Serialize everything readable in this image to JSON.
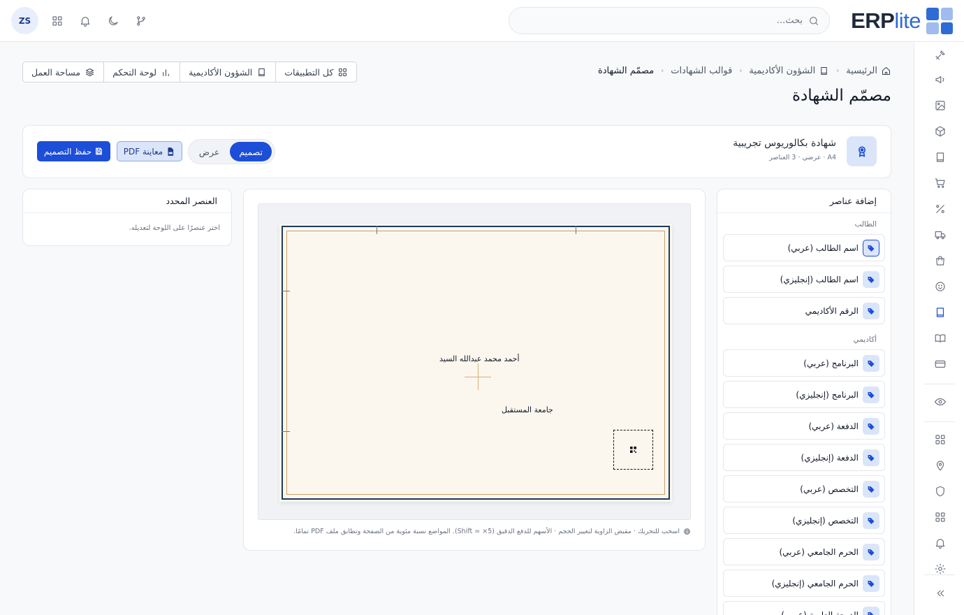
{
  "brand": {
    "name_main": "ERP",
    "name_suffix": "lite",
    "color": "#2f6bd7"
  },
  "header": {
    "search_placeholder": "بحث...",
    "user_initials": "ZS",
    "icons": [
      "git-branch-icon",
      "moon-icon",
      "bell-icon",
      "apps-grid-icon"
    ]
  },
  "sidebar": {
    "icons": [
      "tools-icon",
      "megaphone-icon",
      "image-icon",
      "box-icon",
      "book-icon",
      "cart-icon",
      "percent-icon",
      "truck-icon",
      "shopping-bag-icon",
      "smile-icon",
      "book-active-icon",
      "open-book-icon",
      "credit-card-icon",
      "eye-icon",
      "grid-icon",
      "map-pin-icon",
      "shield-icon",
      "grid-2-icon",
      "bell-icon",
      "settings-icon",
      "collapse-icon"
    ]
  },
  "breadcrumb": {
    "items": [
      "الرئيسية",
      "الشؤون الأكاديمية",
      "قوالب الشهادات",
      "مصمّم الشهادة"
    ]
  },
  "page_title": "مصمّم الشهادة",
  "quick_links": [
    "كل التطبيقات",
    "الشؤون الأكاديمية",
    "لوحة التحكم",
    "مساحة العمل"
  ],
  "template": {
    "name": "شهادة بكالوريوس تجريبية",
    "meta": "A4 · عرضي · 3 العناصر"
  },
  "mode_switch": {
    "design": "تصميم",
    "view": "عرض",
    "active": "design"
  },
  "actions": {
    "preview_pdf": "معاينة PDF",
    "save_design": "حفظ التصميم"
  },
  "elements_panel": {
    "title": "إضافة عناصر",
    "groups": [
      {
        "label": "الطالب",
        "items": [
          "اسم الطالب (عربي)",
          "اسم الطالب (إنجليزي)",
          "الرقم الأكاديمي"
        ]
      },
      {
        "label": "أكاديمي",
        "items": [
          "البرنامج (عربي)",
          "البرنامج (إنجليزي)",
          "الدفعة (عربي)",
          "الدفعة (إنجليزي)",
          "التخصص (عربي)",
          "التخصص (إنجليزي)",
          "الحرم الجامعي (عربي)",
          "الحرم الجامعي (إنجليزي)",
          "الدرجة العلمية (عربي)"
        ]
      }
    ],
    "selected_item": "اسم الطالب (عربي)"
  },
  "selected_panel": {
    "title": "العنصر المحدد",
    "hint": "اختر عنصرًا على اللوحة لتعديله."
  },
  "canvas": {
    "student_name": "أحمد محمد عبدالله السيد",
    "university": "جامعة المستقبل",
    "hint": "اسحب للتحريك · مقبض الزاوية لتغيير الحجم · الأسهم للدفع الدقيق (Shift = ×5). المواضع نسبة مئوية من الصفحة وتطابق ملف PDF تمامًا."
  },
  "colors": {
    "primary": "#1d4ed8",
    "frame_outer": "#1e3a5f",
    "frame_inner": "#c9a06a",
    "paper": "#fbf7ee"
  }
}
